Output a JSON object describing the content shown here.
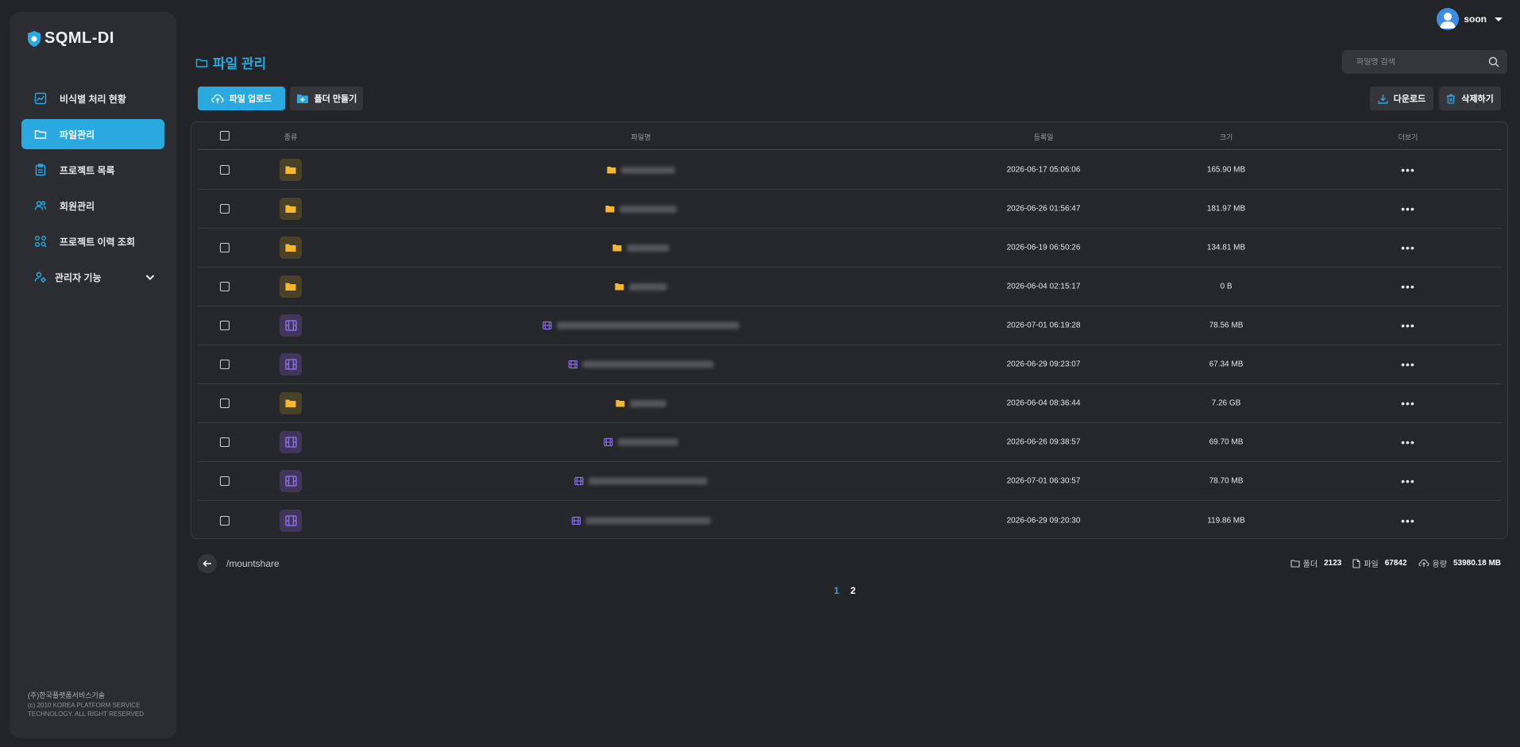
{
  "app": {
    "logo_text": "SQML-DI"
  },
  "sidebar": {
    "items": [
      {
        "label": "비식별 처리 현황",
        "icon": "chart-line-icon"
      },
      {
        "label": "파일관리",
        "icon": "folder-icon",
        "active": true
      },
      {
        "label": "프로젝트 목록",
        "icon": "clipboard-icon"
      },
      {
        "label": "회원관리",
        "icon": "users-icon"
      },
      {
        "label": "프로젝트 이력 조회",
        "icon": "history-search-icon"
      },
      {
        "label": "관리자 기능",
        "icon": "admin-gear-icon",
        "expandable": true
      }
    ],
    "footer": {
      "company": "(주)한국플랫폼서비스기술",
      "line1": "(c) 2010 KOREA PLATFORM SERVICE",
      "line2": "TECHNOLOGY. ALL RIGHT RESERVED"
    }
  },
  "user": {
    "name": "soon"
  },
  "page": {
    "title": "파일 관리",
    "search_placeholder": "파일명 검색"
  },
  "toolbar": {
    "upload_label": "파일 업로드",
    "new_folder_label": "폴더 만들기",
    "download_label": "다운로드",
    "delete_label": "삭제하기"
  },
  "table": {
    "headers": {
      "type": "종류",
      "name": "파일명",
      "date": "등록일",
      "size": "크기",
      "more": "더보기"
    },
    "rows": [
      {
        "type": "folder",
        "date": "2026-06-17 05:06:06",
        "size": "165.90 MB"
      },
      {
        "type": "folder",
        "date": "2026-06-26 01:56:47",
        "size": "181.97 MB"
      },
      {
        "type": "folder",
        "date": "2026-06-19 06:50:26",
        "size": "134.81 MB"
      },
      {
        "type": "folder",
        "date": "2026-06-04 02:15:17",
        "size": "0 B"
      },
      {
        "type": "video",
        "date": "2026-07-01 06:19:28",
        "size": "78.56 MB"
      },
      {
        "type": "video",
        "date": "2026-06-29 09:23:07",
        "size": "67.34 MB"
      },
      {
        "type": "folder",
        "date": "2026-06-04 08:36:44",
        "size": "7.26 GB"
      },
      {
        "type": "video",
        "date": "2026-06-26 09:38:57",
        "size": "69.70 MB"
      },
      {
        "type": "video",
        "date": "2026-07-01 06:30:57",
        "size": "78.70 MB"
      },
      {
        "type": "video",
        "date": "2026-06-29 09:20:30",
        "size": "119.86 MB"
      }
    ]
  },
  "footer": {
    "path": "/mountshare",
    "folders_label": "폴더",
    "folders_count": "2123",
    "files_label": "파일",
    "files_count": "67842",
    "usage_label": "용량",
    "usage_value": "53980.18 MB"
  },
  "pagination": {
    "pages": [
      "1",
      "2"
    ],
    "current": "1"
  },
  "colors": {
    "accent": "#29a9e0",
    "folder": "#f5b82e",
    "video": "#8a6ce8",
    "background": "#232428",
    "sidebar": "#2c2d32"
  }
}
